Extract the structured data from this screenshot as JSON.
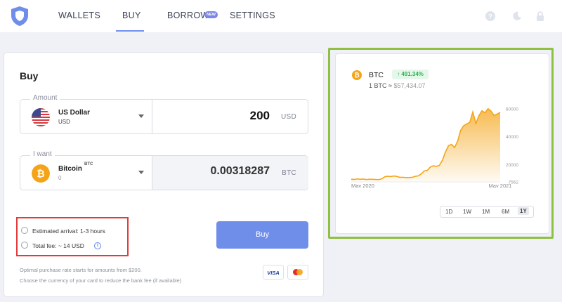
{
  "nav": {
    "items": [
      "WALLETS",
      "BUY",
      "BORROW",
      "SETTINGS"
    ],
    "new_badge": "NEW",
    "active": "BUY"
  },
  "buy": {
    "title": "Buy",
    "amount": {
      "legend": "Amount",
      "currency_name": "US Dollar",
      "currency_code": "USD",
      "value": "200",
      "unit": "USD"
    },
    "want": {
      "legend": "I want",
      "currency_name": "Bitcoin",
      "currency_ticker": "BTC",
      "balance": "0",
      "value": "0.00318287",
      "unit": "BTC"
    },
    "estimated_arrival": "Estimated arrival: 1-3 hours",
    "total_fee": "Total fee: ~ 14 USD",
    "buy_button": "Buy",
    "note_line1": "Optimal purchase rate starts for amounts from $200.",
    "note_line2": "Choose the currency of your card to reduce the bank fee (if available)",
    "visa_label": "VISA"
  },
  "chart_panel": {
    "coin": "BTC",
    "change": "↑ 491.34%",
    "rate_prefix": "1 BTC ≈ ",
    "rate_value": "$57,434.07",
    "ranges": [
      "1D",
      "1W",
      "1M",
      "6M",
      "1Y"
    ],
    "active_range": "1Y"
  },
  "colors": {
    "accent": "#6f8eea",
    "btc": "#f5a417",
    "highlight_green": "#8fc03f",
    "highlight_red": "#e23b3b",
    "positive": "#2fb350"
  },
  "chart_data": {
    "type": "area",
    "title": "",
    "xlabel": "",
    "ylabel": "",
    "x_tick_labels": [
      "May 2020",
      "May 2021"
    ],
    "y_tick_labels": [
      "60000",
      "40000",
      "20000",
      "7562"
    ],
    "ylim": [
      7562,
      62000
    ],
    "grid": false,
    "series": [
      {
        "values": [
          9500,
          9300,
          9700,
          9400,
          9600,
          9200,
          9500,
          9400,
          9300,
          9200,
          9700,
          11200,
          11600,
          11400,
          11800,
          11500,
          10800,
          10900,
          10600,
          10700,
          10800,
          11500,
          11900,
          13200,
          15400,
          15800,
          18200,
          19100,
          18700,
          19400,
          23200,
          29100,
          33600,
          34500,
          32200,
          36800,
          44600,
          47900,
          49200,
          50300,
          57800,
          49500,
          55100,
          58600,
          57200,
          60100,
          58400,
          55200,
          56300,
          57400
        ]
      }
    ]
  }
}
